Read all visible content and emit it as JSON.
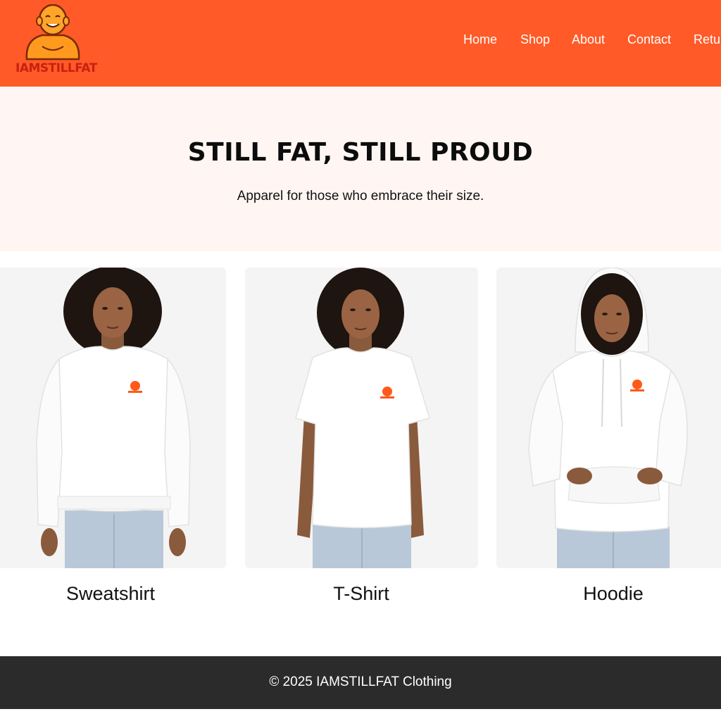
{
  "brand": {
    "name": "IAMSTILLFAT",
    "header_color": "#ff5a28",
    "logo_text_color": "#c8210f"
  },
  "nav": {
    "items": [
      {
        "label": "Home"
      },
      {
        "label": "Shop"
      },
      {
        "label": "About"
      },
      {
        "label": "Contact"
      },
      {
        "label": "Returns"
      }
    ]
  },
  "hero": {
    "title": "STILL FAT, STILL PROUD",
    "subtitle": "Apparel for those who embrace their size."
  },
  "products": [
    {
      "name": "Sweatshirt",
      "image_icon": "sweatshirt-model-image"
    },
    {
      "name": "T-Shirt",
      "image_icon": "tshirt-model-image"
    },
    {
      "name": "Hoodie",
      "image_icon": "hoodie-model-image"
    }
  ],
  "footer": {
    "text": "© 2025 IAMSTILLFAT Clothing"
  }
}
